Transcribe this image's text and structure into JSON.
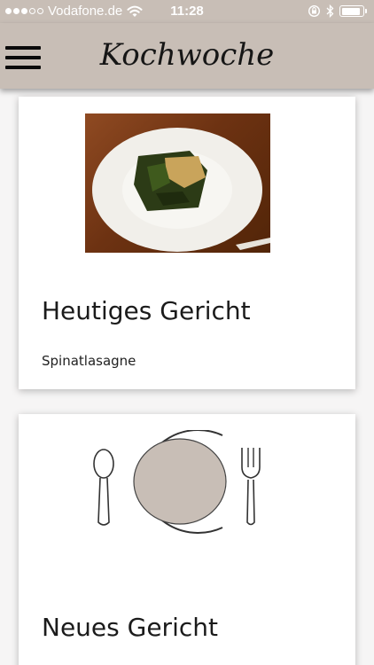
{
  "status_bar": {
    "carrier": "Vodafone.de",
    "time": "11:28",
    "signal_bars_filled": 3,
    "signal_bars_total": 5,
    "battery_level": 0.9
  },
  "header": {
    "title": "Kochwoche",
    "menu_icon": "hamburger-menu-icon",
    "background_color": "#c8beb6"
  },
  "cards": [
    {
      "heading": "Heutiges Gericht",
      "subtitle": "Spinatlasagne",
      "image": "spinach-lasagne-photo"
    },
    {
      "heading": "Neues Gericht",
      "image": "plate-cutlery-icon",
      "plate_color": "#c8beb6"
    }
  ]
}
